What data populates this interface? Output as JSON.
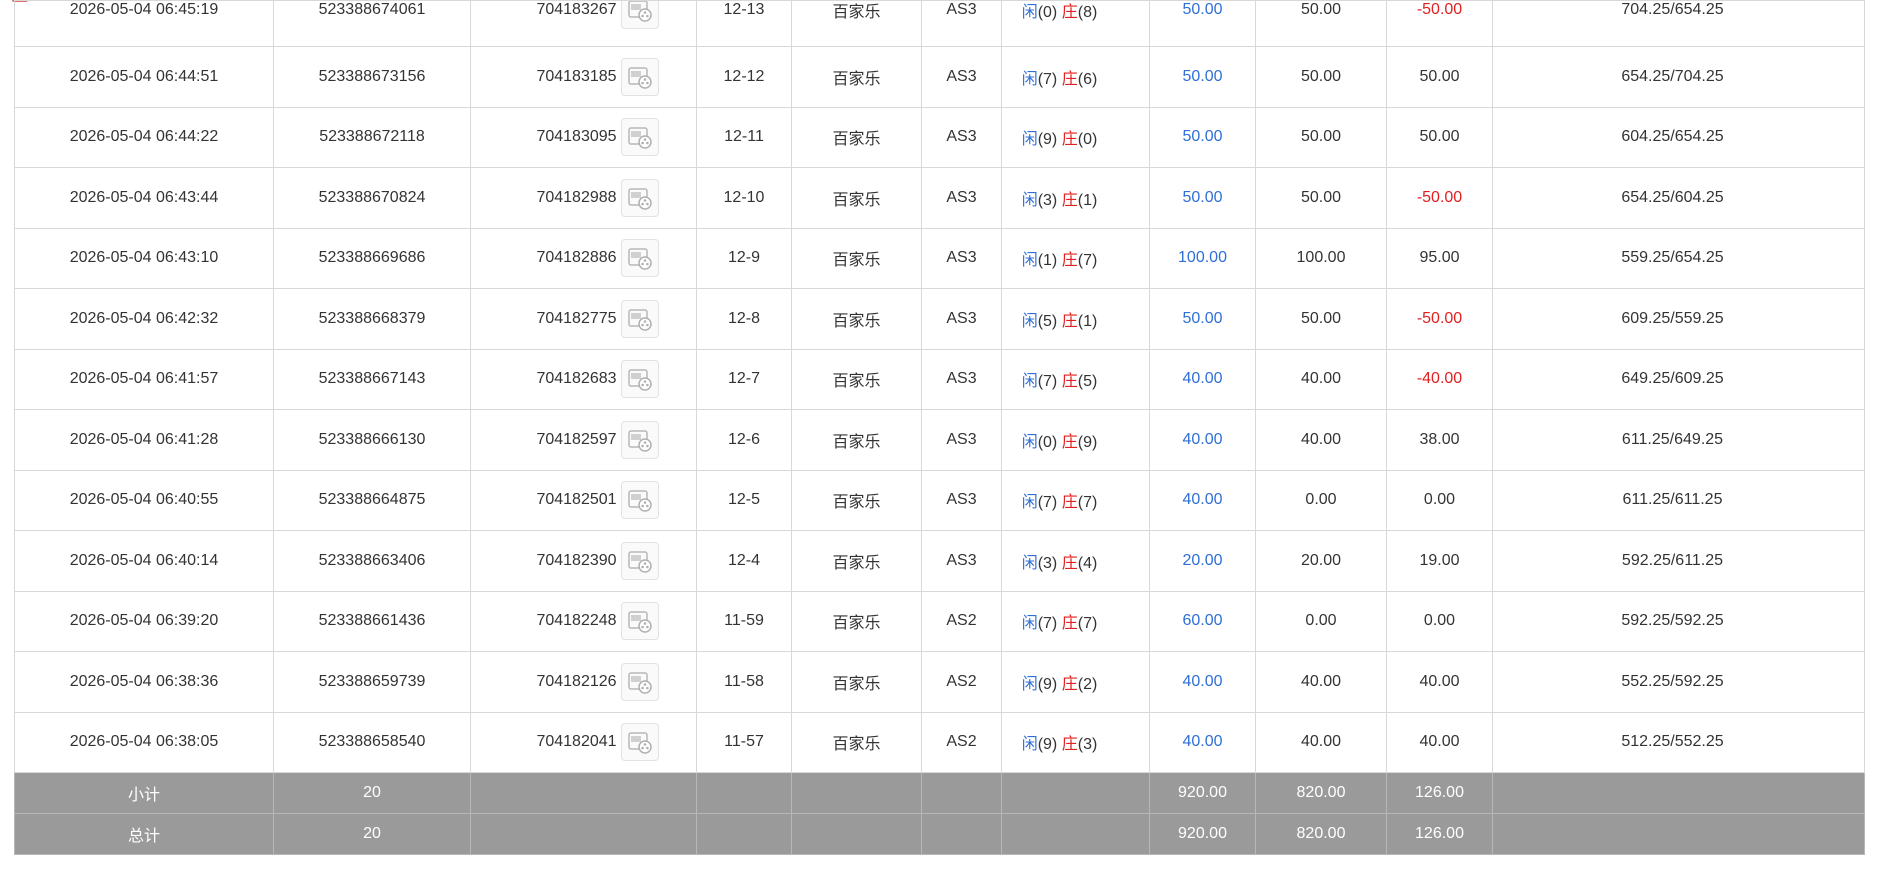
{
  "rows": [
    {
      "time": "2026-05-04 06:45:19",
      "order": "523388674061",
      "round": "704183267",
      "shoe": "12-13",
      "game": "百家乐",
      "table": "AS3",
      "player_label": "闲",
      "player_pts": "(0)",
      "banker_label": "庄",
      "banker_pts": "(8)",
      "bet": "50.00",
      "valid": "50.00",
      "win": "-50.00",
      "win_neg": true,
      "balance": "704.25/654.25"
    },
    {
      "time": "2026-05-04 06:44:51",
      "order": "523388673156",
      "round": "704183185",
      "shoe": "12-12",
      "game": "百家乐",
      "table": "AS3",
      "player_label": "闲",
      "player_pts": "(7)",
      "banker_label": "庄",
      "banker_pts": "(6)",
      "bet": "50.00",
      "valid": "50.00",
      "win": "50.00",
      "win_neg": false,
      "balance": "654.25/704.25"
    },
    {
      "time": "2026-05-04 06:44:22",
      "order": "523388672118",
      "round": "704183095",
      "shoe": "12-11",
      "game": "百家乐",
      "table": "AS3",
      "player_label": "闲",
      "player_pts": "(9)",
      "banker_label": "庄",
      "banker_pts": "(0)",
      "bet": "50.00",
      "valid": "50.00",
      "win": "50.00",
      "win_neg": false,
      "balance": "604.25/654.25"
    },
    {
      "time": "2026-05-04 06:43:44",
      "order": "523388670824",
      "round": "704182988",
      "shoe": "12-10",
      "game": "百家乐",
      "table": "AS3",
      "player_label": "闲",
      "player_pts": "(3)",
      "banker_label": "庄",
      "banker_pts": "(1)",
      "bet": "50.00",
      "valid": "50.00",
      "win": "-50.00",
      "win_neg": true,
      "balance": "654.25/604.25"
    },
    {
      "time": "2026-05-04 06:43:10",
      "order": "523388669686",
      "round": "704182886",
      "shoe": "12-9",
      "game": "百家乐",
      "table": "AS3",
      "player_label": "闲",
      "player_pts": "(1)",
      "banker_label": "庄",
      "banker_pts": "(7)",
      "bet": "100.00",
      "valid": "100.00",
      "win": "95.00",
      "win_neg": false,
      "balance": "559.25/654.25"
    },
    {
      "time": "2026-05-04 06:42:32",
      "order": "523388668379",
      "round": "704182775",
      "shoe": "12-8",
      "game": "百家乐",
      "table": "AS3",
      "player_label": "闲",
      "player_pts": "(5)",
      "banker_label": "庄",
      "banker_pts": "(1)",
      "bet": "50.00",
      "valid": "50.00",
      "win": "-50.00",
      "win_neg": true,
      "balance": "609.25/559.25"
    },
    {
      "time": "2026-05-04 06:41:57",
      "order": "523388667143",
      "round": "704182683",
      "shoe": "12-7",
      "game": "百家乐",
      "table": "AS3",
      "player_label": "闲",
      "player_pts": "(7)",
      "banker_label": "庄",
      "banker_pts": "(5)",
      "bet": "40.00",
      "valid": "40.00",
      "win": "-40.00",
      "win_neg": true,
      "balance": "649.25/609.25"
    },
    {
      "time": "2026-05-04 06:41:28",
      "order": "523388666130",
      "round": "704182597",
      "shoe": "12-6",
      "game": "百家乐",
      "table": "AS3",
      "player_label": "闲",
      "player_pts": "(0)",
      "banker_label": "庄",
      "banker_pts": "(9)",
      "bet": "40.00",
      "valid": "40.00",
      "win": "38.00",
      "win_neg": false,
      "balance": "611.25/649.25"
    },
    {
      "time": "2026-05-04 06:40:55",
      "order": "523388664875",
      "round": "704182501",
      "shoe": "12-5",
      "game": "百家乐",
      "table": "AS3",
      "player_label": "闲",
      "player_pts": "(7)",
      "banker_label": "庄",
      "banker_pts": "(7)",
      "bet": "40.00",
      "valid": "0.00",
      "win": "0.00",
      "win_neg": false,
      "balance": "611.25/611.25"
    },
    {
      "time": "2026-05-04 06:40:14",
      "order": "523388663406",
      "round": "704182390",
      "shoe": "12-4",
      "game": "百家乐",
      "table": "AS3",
      "player_label": "闲",
      "player_pts": "(3)",
      "banker_label": "庄",
      "banker_pts": "(4)",
      "bet": "20.00",
      "valid": "20.00",
      "win": "19.00",
      "win_neg": false,
      "balance": "592.25/611.25"
    },
    {
      "time": "2026-05-04 06:39:20",
      "order": "523388661436",
      "round": "704182248",
      "shoe": "11-59",
      "game": "百家乐",
      "table": "AS2",
      "player_label": "闲",
      "player_pts": "(7)",
      "banker_label": "庄",
      "banker_pts": "(7)",
      "bet": "60.00",
      "valid": "0.00",
      "win": "0.00",
      "win_neg": false,
      "balance": "592.25/592.25"
    },
    {
      "time": "2026-05-04 06:38:36",
      "order": "523388659739",
      "round": "704182126",
      "shoe": "11-58",
      "game": "百家乐",
      "table": "AS2",
      "player_label": "闲",
      "player_pts": "(9)",
      "banker_label": "庄",
      "banker_pts": "(2)",
      "bet": "40.00",
      "valid": "40.00",
      "win": "40.00",
      "win_neg": false,
      "balance": "552.25/592.25"
    },
    {
      "time": "2026-05-04 06:38:05",
      "order": "523388658540",
      "round": "704182041",
      "shoe": "11-57",
      "game": "百家乐",
      "table": "AS2",
      "player_label": "闲",
      "player_pts": "(9)",
      "banker_label": "庄",
      "banker_pts": "(3)",
      "bet": "40.00",
      "valid": "40.00",
      "win": "40.00",
      "win_neg": false,
      "balance": "512.25/552.25"
    }
  ],
  "subtotal": {
    "label": "小计",
    "count": "20",
    "bet": "920.00",
    "valid": "820.00",
    "win": "126.00"
  },
  "total": {
    "label": "总计",
    "count": "20",
    "bet": "920.00",
    "valid": "820.00",
    "win": "126.00"
  },
  "icons": {
    "video": "video-replay-icon"
  },
  "colors": {
    "player": "#2f6fd6",
    "banker": "#e02020",
    "bet": "#2f6fd6",
    "loss": "#e02020",
    "summary_bg": "#9a9a9a"
  }
}
